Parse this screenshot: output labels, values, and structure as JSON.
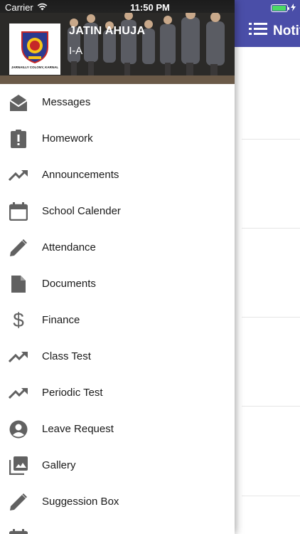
{
  "status_bar": {
    "carrier": "Carrier",
    "time": "11:50 PM"
  },
  "background_screen": {
    "title": "Notif"
  },
  "drawer": {
    "logo_caption": "JARNAILLY COLONY, KARNAL",
    "user_name": "JATIN AHUJA",
    "user_class": "I-A",
    "menu": [
      {
        "label": "Messages",
        "icon": "mail-open-icon"
      },
      {
        "label": "Homework",
        "icon": "clipboard-alert-icon"
      },
      {
        "label": "Announcements",
        "icon": "trending-up-icon"
      },
      {
        "label": "School Calender",
        "icon": "calendar-icon"
      },
      {
        "label": "Attendance",
        "icon": "pencil-icon"
      },
      {
        "label": "Documents",
        "icon": "document-icon"
      },
      {
        "label": "Finance",
        "icon": "dollar-icon"
      },
      {
        "label": "Class Test",
        "icon": "trending-up-icon"
      },
      {
        "label": "Periodic Test",
        "icon": "trending-up-icon"
      },
      {
        "label": "Leave Request",
        "icon": "account-circle-icon"
      },
      {
        "label": "Gallery",
        "icon": "photo-library-icon"
      },
      {
        "label": "Suggession Box",
        "icon": "pencil-icon"
      },
      {
        "label": "",
        "icon": "calendar-icon"
      }
    ]
  },
  "colors": {
    "header_bg": "#4a4ea8",
    "icon_gray": "#616161",
    "battery_green": "#4cd964"
  }
}
